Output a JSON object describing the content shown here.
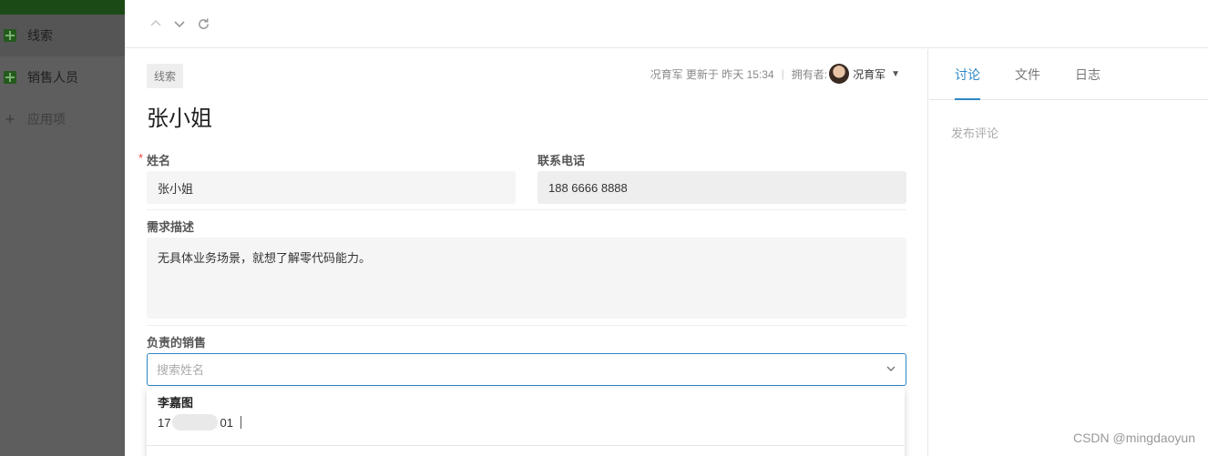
{
  "sidebar": {
    "items": [
      {
        "label": "线索",
        "icon": "add-square-icon"
      },
      {
        "label": "销售人员",
        "icon": "add-square-icon"
      },
      {
        "label": "应用项",
        "icon": "plus-icon"
      }
    ]
  },
  "toolbar": {
    "prev_icon": "chevron-up-icon",
    "next_icon": "chevron-down-icon",
    "refresh_icon": "refresh-icon"
  },
  "record": {
    "tag": "线索",
    "meta_updated": "况育军 更新于 昨天 15:34",
    "owner_label": "拥有者:",
    "owner_name": "况育军",
    "title": "张小姐"
  },
  "fields": {
    "name_label": "姓名",
    "name_value": "张小姐",
    "phone_label": "联系电话",
    "phone_value": "188 6666 8888",
    "desc_label": "需求描述",
    "desc_value": "无具体业务场景，就想了解零代码能力。",
    "sales_label": "负责的销售",
    "sales_placeholder": "搜索姓名"
  },
  "dropdown": {
    "options": [
      {
        "name": "李嘉图",
        "phone_prefix": "17",
        "phone_suffix": "01"
      }
    ]
  },
  "side": {
    "tabs": [
      "讨论",
      "文件",
      "日志"
    ],
    "active_tab": 0,
    "comment_placeholder": "发布评论"
  },
  "watermark": "CSDN @mingdaoyun",
  "colors": {
    "accent": "#2d87c5",
    "required": "#e64a3b",
    "sidebar_overlay": "#5e5e5e"
  }
}
